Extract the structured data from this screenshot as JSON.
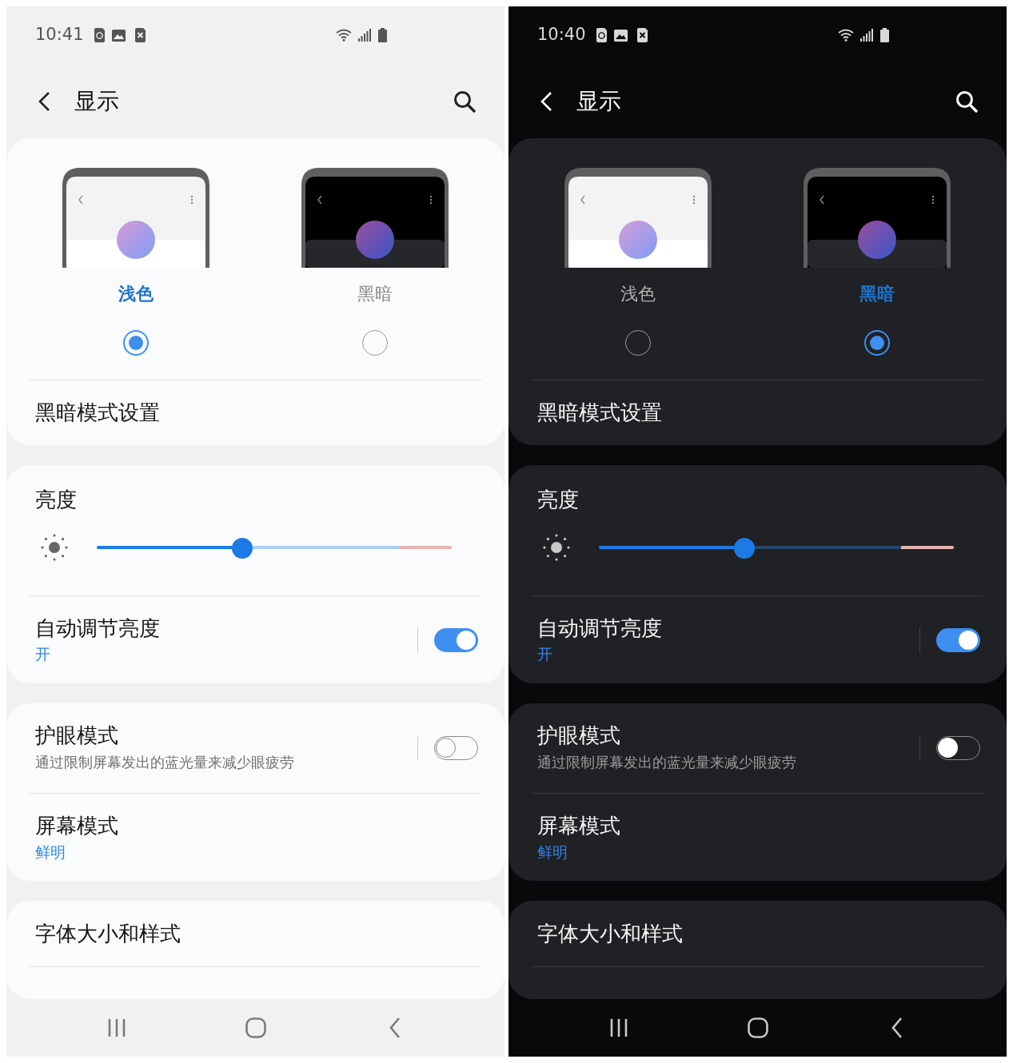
{
  "screens": [
    {
      "kind": "light",
      "status_bar": {
        "time": "10:41"
      },
      "header": {
        "title": "显示"
      },
      "theme_options": [
        {
          "kind": "light",
          "label": "浅色",
          "selected": true
        },
        {
          "kind": "dark",
          "label": "黑暗",
          "selected": false
        }
      ],
      "dark_mode_settings": "黑暗模式设置",
      "brightness": {
        "label": "亮度",
        "level": 0.41
      },
      "auto_brightness": {
        "title": "自动调节亮度",
        "value": "开",
        "on": true
      },
      "eye_comfort": {
        "title": "护眼模式",
        "subtitle": "通过限制屏幕发出的蓝光量来减少眼疲劳",
        "on": false
      },
      "screen_mode": {
        "title": "屏幕模式",
        "value": "鲜明"
      },
      "font_size": "字体大小和样式"
    },
    {
      "kind": "dark",
      "status_bar": {
        "time": "10:40"
      },
      "header": {
        "title": "显示"
      },
      "theme_options": [
        {
          "kind": "light",
          "label": "浅色",
          "selected": false
        },
        {
          "kind": "dark",
          "label": "黑暗",
          "selected": true
        }
      ],
      "dark_mode_settings": "黑暗模式设置",
      "brightness": {
        "label": "亮度",
        "level": 0.41
      },
      "auto_brightness": {
        "title": "自动调节亮度",
        "value": "开",
        "on": true
      },
      "eye_comfort": {
        "title": "护眼模式",
        "subtitle": "通过限制屏幕发出的蓝光量来减少眼疲劳",
        "on": false
      },
      "screen_mode": {
        "title": "屏幕模式",
        "value": "鲜明"
      },
      "font_size": "字体大小和样式"
    }
  ]
}
